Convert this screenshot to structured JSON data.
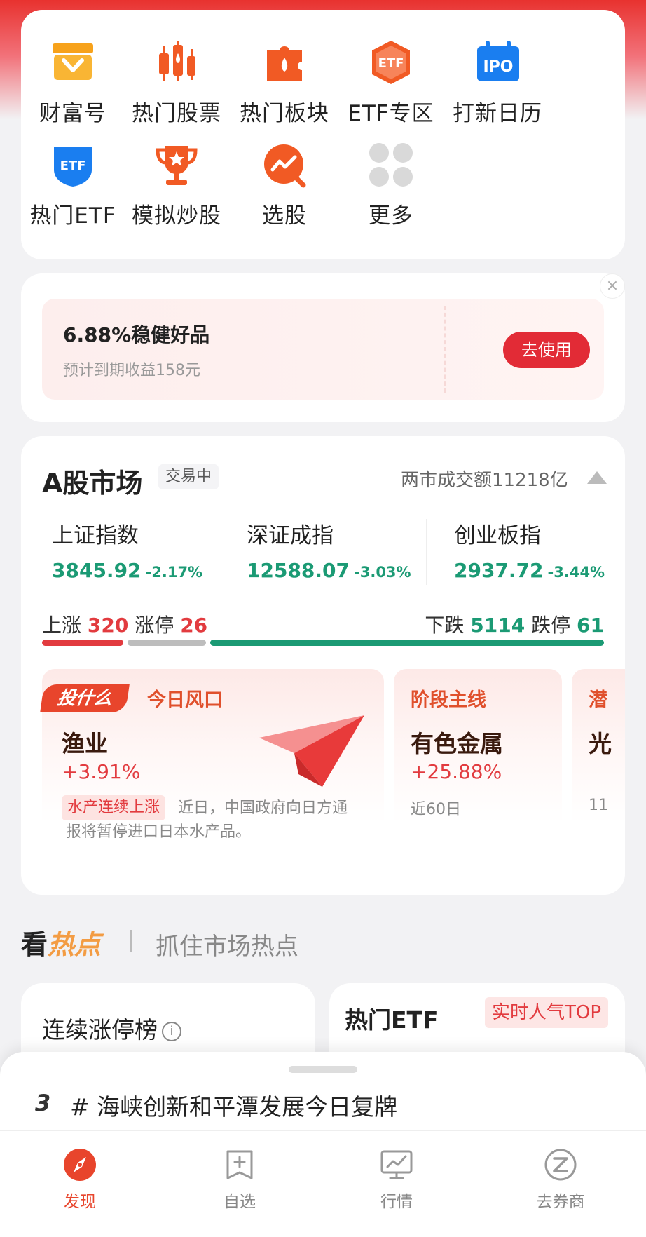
{
  "quick_grid": [
    {
      "label": "财富号",
      "icon": "shop-icon"
    },
    {
      "label": "热门股票",
      "icon": "candlestick-icon"
    },
    {
      "label": "热门板块",
      "icon": "puzzle-icon"
    },
    {
      "label": "ETF专区",
      "icon": "etf-badge-icon",
      "icon_text": "ETF"
    },
    {
      "label": "打新日历",
      "icon": "ipo-calendar-icon",
      "icon_text": "IPO"
    },
    {
      "label": "热门ETF",
      "icon": "etf-shield-icon",
      "icon_text": "ETF"
    },
    {
      "label": "模拟炒股",
      "icon": "trophy-icon"
    },
    {
      "label": "选股",
      "icon": "trend-search-icon"
    },
    {
      "label": "更多",
      "icon": "more-grid-icon"
    }
  ],
  "promo": {
    "title": "6.88%稳健好品",
    "subtitle": "预计到期收益158元",
    "button": "去使用",
    "close": "×"
  },
  "market": {
    "title": "A股市场",
    "status": "交易中",
    "turnover": "两市成交额11218亿",
    "indices": [
      {
        "name": "上证指数",
        "value": "3845.92",
        "change": "-2.17%"
      },
      {
        "name": "深证成指",
        "value": "12588.07",
        "change": "-3.03%"
      },
      {
        "name": "创业板指",
        "value": "2937.72",
        "change": "-3.44%"
      }
    ],
    "breadth": {
      "up_label": "上涨",
      "up": "320",
      "limit_up_label": "涨停",
      "limit_up": "26",
      "down_label": "下跌",
      "down": "5114",
      "limit_down_label": "跌停",
      "limit_down": "61"
    },
    "colors": {
      "up": "#e23b3f",
      "down": "#1b9a74",
      "flat": "#bdbdbd"
    }
  },
  "themes": {
    "main": {
      "badge": "投什么",
      "head": "今日风口",
      "name": "渔业",
      "change": "+3.91%",
      "tag": "水产连续上涨",
      "desc": "近日，中国政府向日方通报将暂停进口日本水产品。"
    },
    "second": {
      "head": "阶段主线",
      "name": "有色金属",
      "change": "+25.88%",
      "note": "近60日"
    },
    "third": {
      "head": "潜",
      "name": "光",
      "note": "11"
    }
  },
  "hot": {
    "title_a": "看",
    "title_b": "热点",
    "subtitle": "抓住市场热点",
    "limit_title": "连续涨停榜",
    "etf_title": "热门ETF",
    "etf_tag": "实时人气TOP"
  },
  "sheet": {
    "rank": "3",
    "topic": "# 海峡创新和平潭发展今日复牌"
  },
  "tabs": [
    {
      "label": "发现",
      "icon": "compass-icon",
      "active": true
    },
    {
      "label": "自选",
      "icon": "watchlist-add-icon"
    },
    {
      "label": "行情",
      "icon": "market-monitor-icon"
    },
    {
      "label": "去券商",
      "icon": "broker-z-icon"
    }
  ],
  "brand_color": "#e8452c"
}
